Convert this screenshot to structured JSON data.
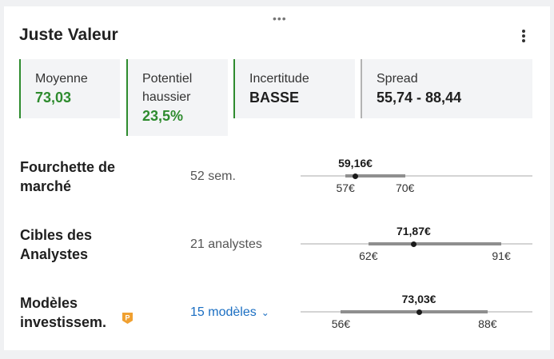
{
  "header": {
    "title": "Juste Valeur"
  },
  "icons": {
    "drag": "drag-handle-icon",
    "menu": "more-vertical-icon",
    "pro": "pro-badge-icon"
  },
  "colors": {
    "positive": "#2e8b2e",
    "neutral": "#b3b3b3",
    "link": "#1a6ec2"
  },
  "stats": [
    {
      "label": "Moyenne",
      "value": "73,03"
    },
    {
      "label": "Potentiel haussier",
      "value": "23,5%"
    },
    {
      "label": "Incertitude",
      "value": "BASSE"
    },
    {
      "label": "Spread",
      "value": "55,74 - 88,44"
    }
  ],
  "rows": [
    {
      "title": "Fourchette de marché",
      "subtitle": "52 sem.",
      "current_label": "59,16€",
      "low_label": "57€",
      "high_label": "70€",
      "current_value": 59.16,
      "low": 57,
      "high": 70
    },
    {
      "title": "Cibles des Analystes",
      "subtitle": "21 analystes",
      "current_label": "71,87€",
      "low_label": "62€",
      "high_label": "91€",
      "current_value": 71.87,
      "low": 62,
      "high": 91
    },
    {
      "title": "Modèles investissem.",
      "subtitle": "15 modèles",
      "current_label": "73,03€",
      "low_label": "56€",
      "high_label": "88€",
      "current_value": 73.03,
      "low": 56,
      "high": 88
    }
  ]
}
